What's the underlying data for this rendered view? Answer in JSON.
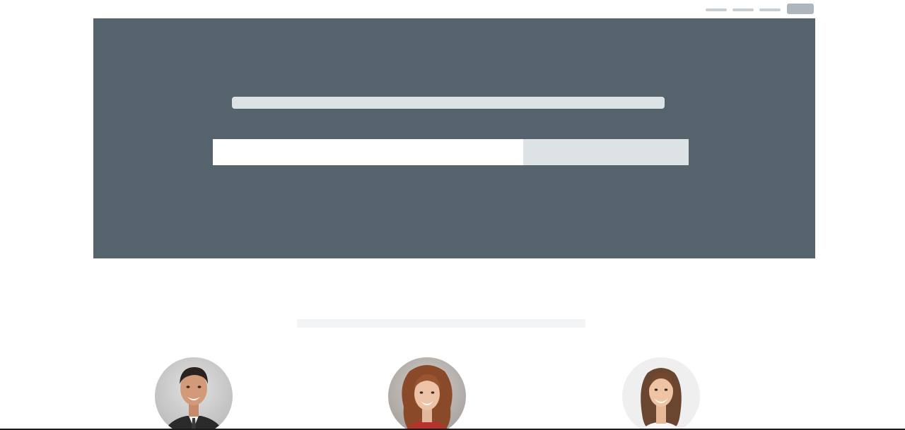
{
  "nav": {
    "items": [
      "",
      "",
      ""
    ],
    "cta_label": ""
  },
  "hero": {
    "title": "",
    "email_input": {
      "value": "",
      "placeholder": ""
    },
    "submit_label": ""
  },
  "team_section": {
    "heading": "",
    "members": [
      {
        "name": "",
        "photo": "man-in-suit-portrait"
      },
      {
        "name": "",
        "photo": "woman-curly-hair-portrait"
      },
      {
        "name": "",
        "photo": "woman-smiling-portrait"
      }
    ]
  },
  "colors": {
    "hero_background": "#55636d",
    "placeholder_light": "#dde2e5",
    "nav_placeholder": "#c9ced3",
    "nav_button": "#aeb6bd"
  }
}
